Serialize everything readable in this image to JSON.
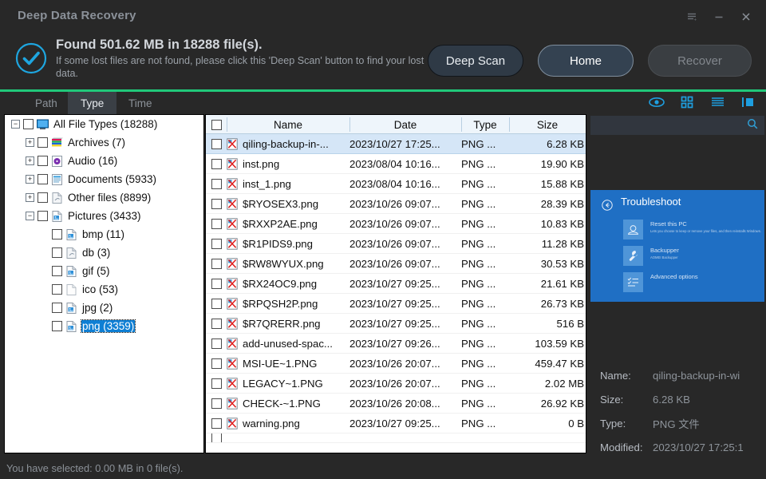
{
  "window": {
    "title": "Deep Data Recovery",
    "controls": [
      {
        "name": "menu-icon",
        "label": "menu"
      },
      {
        "name": "minimize-icon",
        "label": "minimize"
      },
      {
        "name": "close-icon",
        "label": "close"
      }
    ]
  },
  "header": {
    "status_icon": "check-circle-icon",
    "title": "Found 501.62 MB in 18288 file(s).",
    "subtitle": "If some lost files are not found, please click this 'Deep Scan' button to find your lost data.",
    "buttons": {
      "deep_scan": "Deep Scan",
      "home": "Home",
      "recover": "Recover"
    },
    "accent_color": "#21c87a"
  },
  "tabs": [
    {
      "label": "Path",
      "selected": false
    },
    {
      "label": "Type",
      "selected": true
    },
    {
      "label": "Time",
      "selected": false
    }
  ],
  "view_icons": [
    {
      "name": "eye-icon",
      "label": "preview"
    },
    {
      "name": "grid-view-icon",
      "label": "grid view"
    },
    {
      "name": "list-view-icon",
      "label": "list view"
    },
    {
      "name": "detail-panel-icon",
      "label": "detail panel"
    }
  ],
  "tree": {
    "nodes": [
      {
        "label": "All File Types (18288)",
        "depth": 0,
        "toggle": "minus",
        "icon": "monitor-icon",
        "selected": false
      },
      {
        "label": "Archives (7)",
        "depth": 1,
        "toggle": "plus",
        "icon": "archive-icon",
        "selected": false
      },
      {
        "label": "Audio (16)",
        "depth": 1,
        "toggle": "plus",
        "icon": "audio-icon",
        "selected": false
      },
      {
        "label": "Documents (5933)",
        "depth": 1,
        "toggle": "plus",
        "icon": "document-icon",
        "selected": false
      },
      {
        "label": "Other files (8899)",
        "depth": 1,
        "toggle": "plus",
        "icon": "other-file-icon",
        "selected": false
      },
      {
        "label": "Pictures (3433)",
        "depth": 1,
        "toggle": "minus",
        "icon": "picture-icon",
        "selected": false
      },
      {
        "label": "bmp (11)",
        "depth": 2,
        "toggle": "none",
        "icon": "picture-icon",
        "selected": false
      },
      {
        "label": "db (3)",
        "depth": 2,
        "toggle": "none",
        "icon": "other-file-icon",
        "selected": false
      },
      {
        "label": "gif (5)",
        "depth": 2,
        "toggle": "none",
        "icon": "picture-icon",
        "selected": false
      },
      {
        "label": "ico (53)",
        "depth": 2,
        "toggle": "none",
        "icon": "blank-file-icon",
        "selected": false
      },
      {
        "label": "jpg (2)",
        "depth": 2,
        "toggle": "none",
        "icon": "picture-icon",
        "selected": false
      },
      {
        "label": "png (3359)",
        "depth": 2,
        "toggle": "none",
        "icon": "picture-icon",
        "selected": true
      }
    ]
  },
  "filelist": {
    "columns": [
      "",
      "Name",
      "Date",
      "Type",
      "Size"
    ],
    "rows": [
      {
        "name": "qiling-backup-in-...",
        "date": "2023/10/27 17:25...",
        "type": "PNG ...",
        "size": "6.28 KB",
        "selected": true
      },
      {
        "name": "inst.png",
        "date": "2023/08/04 10:16...",
        "type": "PNG ...",
        "size": "19.90 KB",
        "selected": false
      },
      {
        "name": "inst_1.png",
        "date": "2023/08/04 10:16...",
        "type": "PNG ...",
        "size": "15.88 KB",
        "selected": false
      },
      {
        "name": "$RYOSEX3.png",
        "date": "2023/10/26 09:07...",
        "type": "PNG ...",
        "size": "28.39 KB",
        "selected": false
      },
      {
        "name": "$RXXP2AE.png",
        "date": "2023/10/26 09:07...",
        "type": "PNG ...",
        "size": "10.83 KB",
        "selected": false
      },
      {
        "name": "$R1PIDS9.png",
        "date": "2023/10/26 09:07...",
        "type": "PNG ...",
        "size": "11.28 KB",
        "selected": false
      },
      {
        "name": "$RW8WYUX.png",
        "date": "2023/10/26 09:07...",
        "type": "PNG ...",
        "size": "30.53 KB",
        "selected": false
      },
      {
        "name": "$RX24OC9.png",
        "date": "2023/10/27 09:25...",
        "type": "PNG ...",
        "size": "21.61 KB",
        "selected": false
      },
      {
        "name": "$RPQSH2P.png",
        "date": "2023/10/27 09:25...",
        "type": "PNG ...",
        "size": "26.73 KB",
        "selected": false
      },
      {
        "name": "$R7QRERR.png",
        "date": "2023/10/27 09:25...",
        "type": "PNG ...",
        "size": "516 B",
        "selected": false
      },
      {
        "name": "add-unused-spac...",
        "date": "2023/10/27 09:26...",
        "type": "PNG ...",
        "size": "103.59 KB",
        "selected": false
      },
      {
        "name": "MSI-UE~1.PNG",
        "date": "2023/10/26 20:07...",
        "type": "PNG ...",
        "size": "459.47 KB",
        "selected": false
      },
      {
        "name": "LEGACY~1.PNG",
        "date": "2023/10/26 20:07...",
        "type": "PNG ...",
        "size": "2.02 MB",
        "selected": false
      },
      {
        "name": "CHECK-~1.PNG",
        "date": "2023/10/26 20:08...",
        "type": "PNG ...",
        "size": "26.92 KB",
        "selected": false
      },
      {
        "name": "warning.png",
        "date": "2023/10/27 09:25...",
        "type": "PNG ...",
        "size": "0 B",
        "selected": false
      }
    ]
  },
  "right": {
    "search_placeholder": "",
    "search_value": "",
    "search_icon": "search-icon",
    "preview": {
      "back_icon": "back-arrow-icon",
      "title": "Troubleshoot",
      "tiles": [
        {
          "icon": "reset-pc-icon",
          "title": "Reset this PC",
          "subtitle": "Lets you choose to keep or remove your files, and then reinstalls Windows."
        },
        {
          "icon": "wrench-icon",
          "title": "Backupper",
          "subtitle": "AOMEI Backupper"
        },
        {
          "icon": "checklist-icon",
          "title": "Advanced options",
          "subtitle": ""
        }
      ]
    },
    "info": [
      {
        "key": "Name:",
        "value": "qiling-backup-in-wi"
      },
      {
        "key": "Size:",
        "value": "6.28 KB"
      },
      {
        "key": "Type:",
        "value": "PNG 文件"
      },
      {
        "key": "Modified:",
        "value": "2023/10/27 17:25:1"
      }
    ]
  },
  "statusbar": {
    "text": "You have selected: 0.00 MB in 0 file(s)."
  }
}
